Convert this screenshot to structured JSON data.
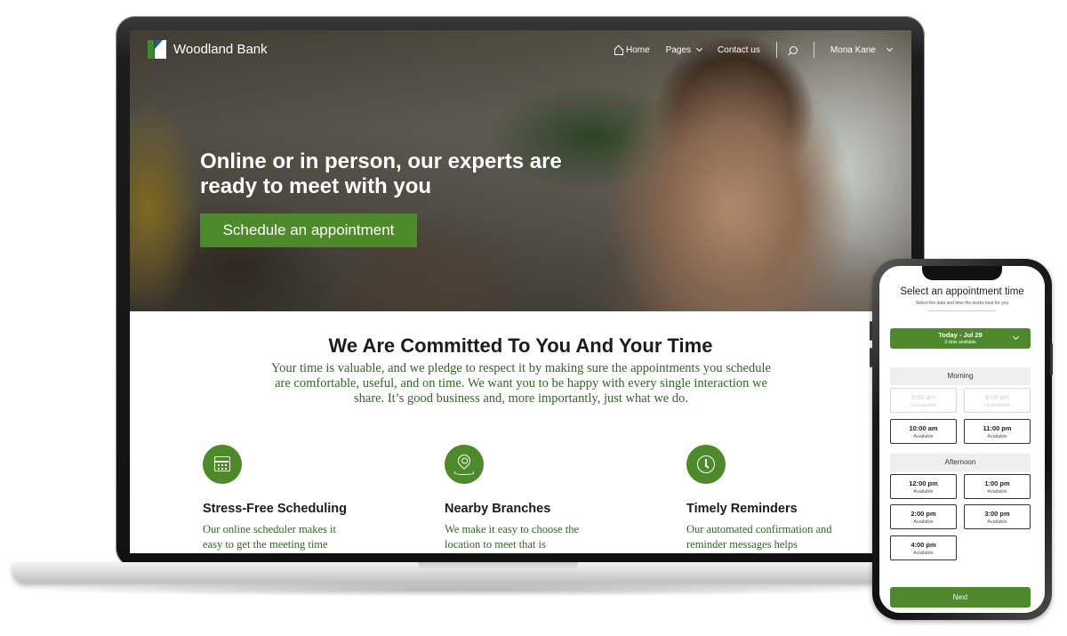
{
  "site": {
    "brand": "Woodland Bank",
    "nav": {
      "home": "Home",
      "pages": "Pages",
      "contact": "Contact us",
      "user": "Mona Kane"
    },
    "hero": {
      "title": "Online or in person, our experts are ready to meet with you",
      "cta": "Schedule an appointment"
    },
    "commitment": {
      "title": "We Are Committed To You And Your Time",
      "body": "Your time is valuable, and we pledge to respect it by making sure the appointments you schedule are comfortable, useful, and on time. We want you to be happy with every single interaction we share. It’s good business and, more importantly, just what we do."
    },
    "features": [
      {
        "icon": "calendar-icon",
        "title": "Stress-Free Scheduling",
        "text": "Our online scheduler makes it easy to get the meeting time"
      },
      {
        "icon": "location-pin-icon",
        "title": "Nearby Branches",
        "text": "We make it easy to choose the location to meet that is"
      },
      {
        "icon": "clock-icon",
        "title": "Timely Reminders",
        "text": "Our automated confirmation and reminder messages helps"
      }
    ]
  },
  "phone": {
    "title": "Select an appointment time",
    "subtitle": "Select the date and time the works best for you",
    "date": {
      "label": "Today - Jul 29",
      "sub": "3 slots available"
    },
    "morning_label": "Morning",
    "afternoon_label": "Afternoon",
    "morning_slots": [
      {
        "time": "8:00 am",
        "status": "Unavailable"
      },
      {
        "time": "9:00 pm",
        "status": "Unavailable"
      },
      {
        "time": "10:00 am",
        "status": "Available"
      },
      {
        "time": "11:00 pm",
        "status": "Available"
      }
    ],
    "afternoon_slots": [
      {
        "time": "12:00 pm",
        "status": "Available"
      },
      {
        "time": "1:00 pm",
        "status": "Available"
      },
      {
        "time": "2:00 pm",
        "status": "Available"
      },
      {
        "time": "3:00 pm",
        "status": "Available"
      },
      {
        "time": "4:00 pm",
        "status": "Available"
      }
    ],
    "next": "Next"
  },
  "colors": {
    "accent": "#4e8a2c",
    "body_text": "#2f6a24"
  }
}
